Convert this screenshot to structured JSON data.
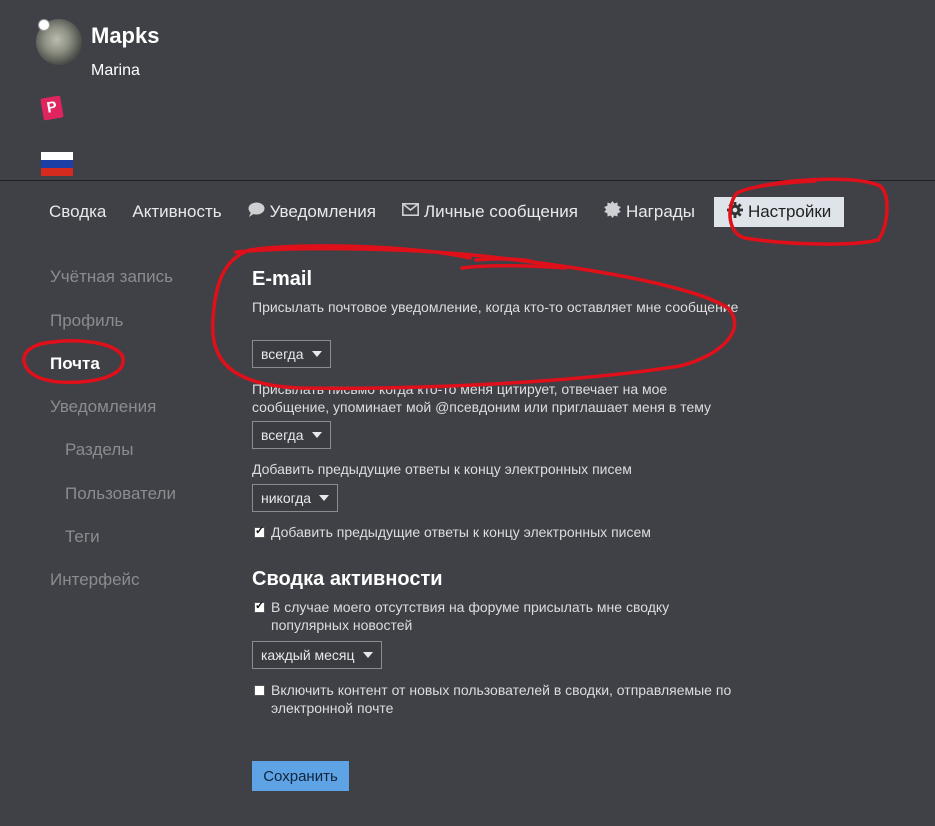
{
  "user": {
    "username": "Mapks",
    "name": "Marina",
    "badge_letter": "P"
  },
  "colors": {
    "background": "#3f4147",
    "accent": "#5ea3e6",
    "annotation": "#e0101a",
    "badge": "#e0245e"
  },
  "nav": {
    "items": [
      {
        "label": "Сводка",
        "icon": ""
      },
      {
        "label": "Активность",
        "icon": ""
      },
      {
        "label": "Уведомления",
        "icon": "speech-bubble-icon"
      },
      {
        "label": "Личные сообщения",
        "icon": "envelope-icon"
      },
      {
        "label": "Награды",
        "icon": "certificate-icon"
      },
      {
        "label": "Настройки",
        "icon": "gear-icon",
        "active": true
      }
    ]
  },
  "sidebar": {
    "items": [
      {
        "label": "Учётная запись"
      },
      {
        "label": "Профиль"
      },
      {
        "label": "Почта",
        "active": true
      },
      {
        "label": "Уведомления"
      },
      {
        "label": "Разделы",
        "sub": true
      },
      {
        "label": "Пользователи",
        "sub": true
      },
      {
        "label": "Теги",
        "sub": true
      },
      {
        "label": "Интерфейс"
      }
    ]
  },
  "email": {
    "title": "E-mail",
    "pm_label": "Присылать почтовое уведомление, когда кто-то оставляет мне сообщение",
    "pm_value": "всегда",
    "quote_label": "Присылать письмо когда кто-то меня цитирует, отвечает на мое сообщение, упоминает мой @псевдоним или приглашает меня в тему",
    "quote_value": "всегда",
    "prev_label": "Добавить предыдущие ответы к концу электронных писем",
    "prev_value": "никогда",
    "prev_checkbox_label": "Добавить предыдущие ответы к концу электронных писем",
    "prev_checkbox_checked": true
  },
  "digest": {
    "title": "Сводка активности",
    "absence_label": "В случае моего отсутствия на форуме присылать мне сводку популярных новостей",
    "absence_checked": true,
    "frequency_value": "каждый месяц",
    "new_users_label": "Включить контент от новых пользователей в сводки, отправляемые по электронной почте",
    "new_users_checked": false
  },
  "save_label": "Сохранить"
}
